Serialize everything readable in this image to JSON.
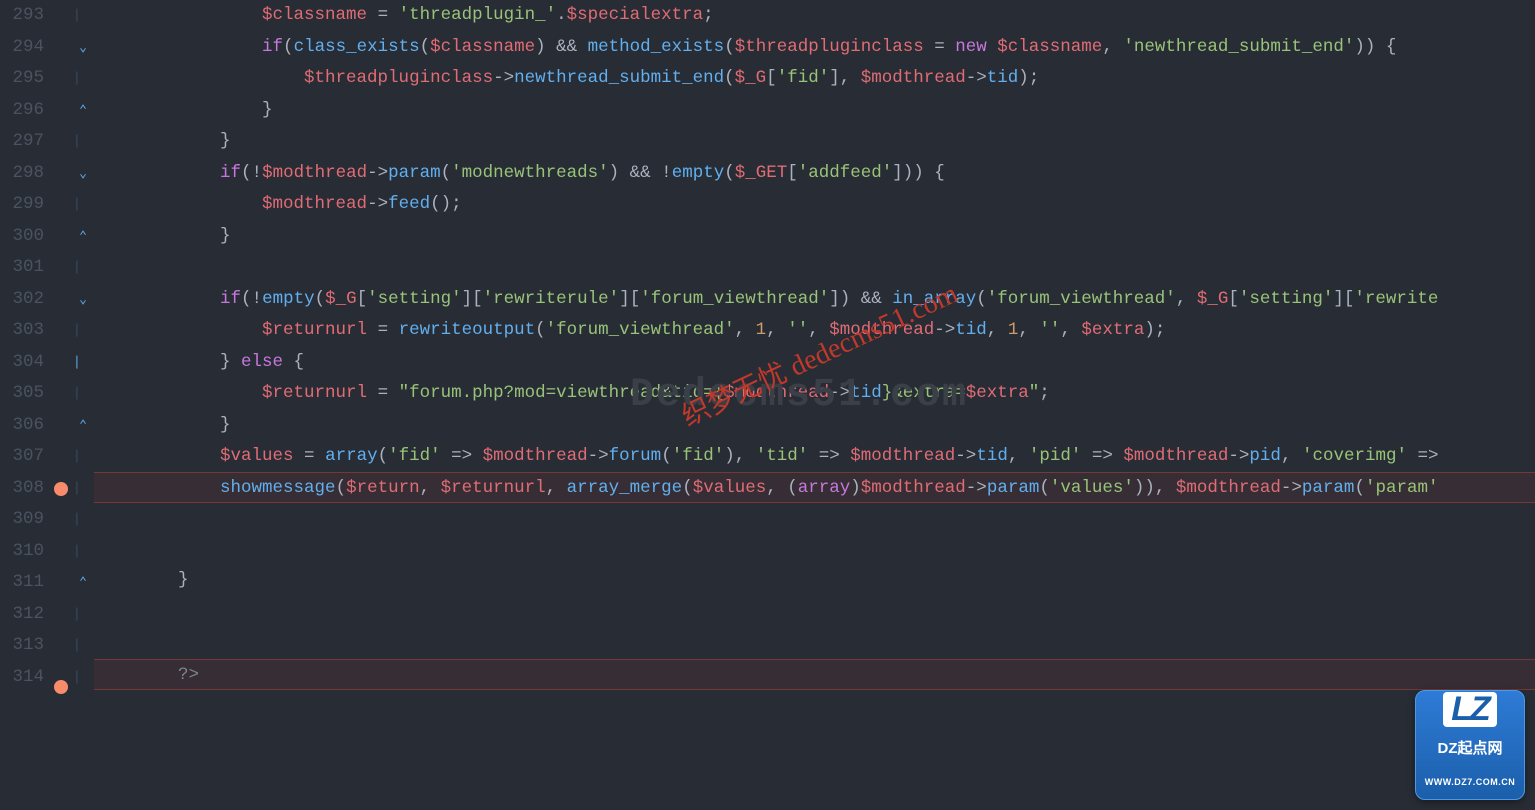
{
  "lines": {
    "start": 293,
    "end": 314
  },
  "breakpoints": [
    308,
    314
  ],
  "fold_markers": {
    "294": "open",
    "296": "close",
    "298": "open",
    "300": "close",
    "302": "open",
    "304": "mid",
    "306": "close",
    "311": "close"
  },
  "code": {
    "293": [
      {
        "t": "                ",
        "c": "p"
      },
      {
        "t": "$classname",
        "c": "v"
      },
      {
        "t": " = ",
        "c": "p"
      },
      {
        "t": "'threadplugin_'",
        "c": "s"
      },
      {
        "t": ".",
        "c": "p"
      },
      {
        "t": "$specialextra",
        "c": "v"
      },
      {
        "t": ";",
        "c": "p"
      }
    ],
    "294": [
      {
        "t": "                ",
        "c": "p"
      },
      {
        "t": "if",
        "c": "k"
      },
      {
        "t": "(",
        "c": "p"
      },
      {
        "t": "class_exists",
        "c": "f"
      },
      {
        "t": "(",
        "c": "p"
      },
      {
        "t": "$classname",
        "c": "v"
      },
      {
        "t": ") && ",
        "c": "p"
      },
      {
        "t": "method_exists",
        "c": "f"
      },
      {
        "t": "(",
        "c": "p"
      },
      {
        "t": "$threadpluginclass",
        "c": "v"
      },
      {
        "t": " = ",
        "c": "p"
      },
      {
        "t": "new",
        "c": "k"
      },
      {
        "t": " ",
        "c": "p"
      },
      {
        "t": "$classname",
        "c": "v"
      },
      {
        "t": ", ",
        "c": "p"
      },
      {
        "t": "'newthread_submit_end'",
        "c": "s"
      },
      {
        "t": ")) {",
        "c": "p"
      }
    ],
    "295": [
      {
        "t": "                    ",
        "c": "p"
      },
      {
        "t": "$threadpluginclass",
        "c": "v"
      },
      {
        "t": "->",
        "c": "p"
      },
      {
        "t": "newthread_submit_end",
        "c": "f"
      },
      {
        "t": "(",
        "c": "p"
      },
      {
        "t": "$_G",
        "c": "v"
      },
      {
        "t": "[",
        "c": "p"
      },
      {
        "t": "'fid'",
        "c": "s"
      },
      {
        "t": "], ",
        "c": "p"
      },
      {
        "t": "$modthread",
        "c": "v"
      },
      {
        "t": "->",
        "c": "p"
      },
      {
        "t": "tid",
        "c": "f"
      },
      {
        "t": ");",
        "c": "p"
      }
    ],
    "296": [
      {
        "t": "                }",
        "c": "p"
      }
    ],
    "297": [
      {
        "t": "            }",
        "c": "p"
      }
    ],
    "298": [
      {
        "t": "            ",
        "c": "p"
      },
      {
        "t": "if",
        "c": "k"
      },
      {
        "t": "(!",
        "c": "p"
      },
      {
        "t": "$modthread",
        "c": "v"
      },
      {
        "t": "->",
        "c": "p"
      },
      {
        "t": "param",
        "c": "f"
      },
      {
        "t": "(",
        "c": "p"
      },
      {
        "t": "'modnewthreads'",
        "c": "s"
      },
      {
        "t": ") && !",
        "c": "p"
      },
      {
        "t": "empty",
        "c": "f"
      },
      {
        "t": "(",
        "c": "p"
      },
      {
        "t": "$_GET",
        "c": "v"
      },
      {
        "t": "[",
        "c": "p"
      },
      {
        "t": "'addfeed'",
        "c": "s"
      },
      {
        "t": "])) {",
        "c": "p"
      }
    ],
    "299": [
      {
        "t": "                ",
        "c": "p"
      },
      {
        "t": "$modthread",
        "c": "v"
      },
      {
        "t": "->",
        "c": "p"
      },
      {
        "t": "feed",
        "c": "f"
      },
      {
        "t": "();",
        "c": "p"
      }
    ],
    "300": [
      {
        "t": "            }",
        "c": "p"
      }
    ],
    "301": [
      {
        "t": "",
        "c": "p"
      }
    ],
    "302": [
      {
        "t": "            ",
        "c": "p"
      },
      {
        "t": "if",
        "c": "k"
      },
      {
        "t": "(!",
        "c": "p"
      },
      {
        "t": "empty",
        "c": "f"
      },
      {
        "t": "(",
        "c": "p"
      },
      {
        "t": "$_G",
        "c": "v"
      },
      {
        "t": "[",
        "c": "p"
      },
      {
        "t": "'setting'",
        "c": "s"
      },
      {
        "t": "][",
        "c": "p"
      },
      {
        "t": "'rewriterule'",
        "c": "s"
      },
      {
        "t": "][",
        "c": "p"
      },
      {
        "t": "'forum_viewthread'",
        "c": "s"
      },
      {
        "t": "]) && ",
        "c": "p"
      },
      {
        "t": "in_array",
        "c": "f"
      },
      {
        "t": "(",
        "c": "p"
      },
      {
        "t": "'forum_viewthread'",
        "c": "s"
      },
      {
        "t": ", ",
        "c": "p"
      },
      {
        "t": "$_G",
        "c": "v"
      },
      {
        "t": "[",
        "c": "p"
      },
      {
        "t": "'setting'",
        "c": "s"
      },
      {
        "t": "][",
        "c": "p"
      },
      {
        "t": "'rewrite",
        "c": "s"
      }
    ],
    "303": [
      {
        "t": "                ",
        "c": "p"
      },
      {
        "t": "$returnurl",
        "c": "v"
      },
      {
        "t": " = ",
        "c": "p"
      },
      {
        "t": "rewriteoutput",
        "c": "f"
      },
      {
        "t": "(",
        "c": "p"
      },
      {
        "t": "'forum_viewthread'",
        "c": "s"
      },
      {
        "t": ", ",
        "c": "p"
      },
      {
        "t": "1",
        "c": "n"
      },
      {
        "t": ", ",
        "c": "p"
      },
      {
        "t": "''",
        "c": "s"
      },
      {
        "t": ", ",
        "c": "p"
      },
      {
        "t": "$modthread",
        "c": "v"
      },
      {
        "t": "->",
        "c": "p"
      },
      {
        "t": "tid",
        "c": "f"
      },
      {
        "t": ", ",
        "c": "p"
      },
      {
        "t": "1",
        "c": "n"
      },
      {
        "t": ", ",
        "c": "p"
      },
      {
        "t": "''",
        "c": "s"
      },
      {
        "t": ", ",
        "c": "p"
      },
      {
        "t": "$extra",
        "c": "v"
      },
      {
        "t": ");",
        "c": "p"
      }
    ],
    "304": [
      {
        "t": "            } ",
        "c": "p"
      },
      {
        "t": "else",
        "c": "k"
      },
      {
        "t": " {",
        "c": "p"
      }
    ],
    "305": [
      {
        "t": "                ",
        "c": "p"
      },
      {
        "t": "$returnurl",
        "c": "v"
      },
      {
        "t": " = ",
        "c": "p"
      },
      {
        "t": "\"forum.php?mod=viewthread&tid={",
        "c": "s"
      },
      {
        "t": "$modthread",
        "c": "v"
      },
      {
        "t": "->",
        "c": "p"
      },
      {
        "t": "tid",
        "c": "f"
      },
      {
        "t": "}&extra=",
        "c": "s"
      },
      {
        "t": "$extra",
        "c": "v"
      },
      {
        "t": "\"",
        "c": "s"
      },
      {
        "t": ";",
        "c": "p"
      }
    ],
    "306": [
      {
        "t": "            }",
        "c": "p"
      }
    ],
    "307": [
      {
        "t": "            ",
        "c": "p"
      },
      {
        "t": "$values",
        "c": "v"
      },
      {
        "t": " = ",
        "c": "p"
      },
      {
        "t": "array",
        "c": "f"
      },
      {
        "t": "(",
        "c": "p"
      },
      {
        "t": "'fid'",
        "c": "s"
      },
      {
        "t": " => ",
        "c": "p"
      },
      {
        "t": "$modthread",
        "c": "v"
      },
      {
        "t": "->",
        "c": "p"
      },
      {
        "t": "forum",
        "c": "f"
      },
      {
        "t": "(",
        "c": "p"
      },
      {
        "t": "'fid'",
        "c": "s"
      },
      {
        "t": "), ",
        "c": "p"
      },
      {
        "t": "'tid'",
        "c": "s"
      },
      {
        "t": " => ",
        "c": "p"
      },
      {
        "t": "$modthread",
        "c": "v"
      },
      {
        "t": "->",
        "c": "p"
      },
      {
        "t": "tid",
        "c": "f"
      },
      {
        "t": ", ",
        "c": "p"
      },
      {
        "t": "'pid'",
        "c": "s"
      },
      {
        "t": " => ",
        "c": "p"
      },
      {
        "t": "$modthread",
        "c": "v"
      },
      {
        "t": "->",
        "c": "p"
      },
      {
        "t": "pid",
        "c": "f"
      },
      {
        "t": ", ",
        "c": "p"
      },
      {
        "t": "'coverimg'",
        "c": "s"
      },
      {
        "t": " =>",
        "c": "p"
      }
    ],
    "308": [
      {
        "t": "            ",
        "c": "p"
      },
      {
        "t": "showmessage",
        "c": "f"
      },
      {
        "t": "(",
        "c": "p"
      },
      {
        "t": "$return",
        "c": "v"
      },
      {
        "t": ", ",
        "c": "p"
      },
      {
        "t": "$returnurl",
        "c": "v"
      },
      {
        "t": ", ",
        "c": "p"
      },
      {
        "t": "array_merge",
        "c": "f"
      },
      {
        "t": "(",
        "c": "p"
      },
      {
        "t": "$values",
        "c": "v"
      },
      {
        "t": ", (",
        "c": "p"
      },
      {
        "t": "array",
        "c": "k"
      },
      {
        "t": ")",
        "c": "p"
      },
      {
        "t": "$modthread",
        "c": "v"
      },
      {
        "t": "->",
        "c": "p"
      },
      {
        "t": "param",
        "c": "f"
      },
      {
        "t": "(",
        "c": "p"
      },
      {
        "t": "'values'",
        "c": "s"
      },
      {
        "t": ")), ",
        "c": "p"
      },
      {
        "t": "$modthread",
        "c": "v"
      },
      {
        "t": "->",
        "c": "p"
      },
      {
        "t": "param",
        "c": "f"
      },
      {
        "t": "(",
        "c": "p"
      },
      {
        "t": "'param'",
        "c": "s"
      }
    ],
    "309": [
      {
        "t": "",
        "c": "p"
      }
    ],
    "310": [
      {
        "t": "",
        "c": "p"
      }
    ],
    "311": [
      {
        "t": "        }",
        "c": "p"
      }
    ],
    "312": [
      {
        "t": "",
        "c": "p"
      }
    ],
    "313": [
      {
        "t": "",
        "c": "p"
      }
    ],
    "314": [
      {
        "t": "        ",
        "c": "p"
      },
      {
        "t": "?>",
        "c": "c"
      }
    ]
  },
  "watermarks": {
    "faded": "Dedecms51.com",
    "red": "织梦无忧 dedecms51.com"
  },
  "logo": {
    "mark": "LZ",
    "line1": "DZ起点网",
    "line2": "WWW.DZ7.COM.CN"
  }
}
